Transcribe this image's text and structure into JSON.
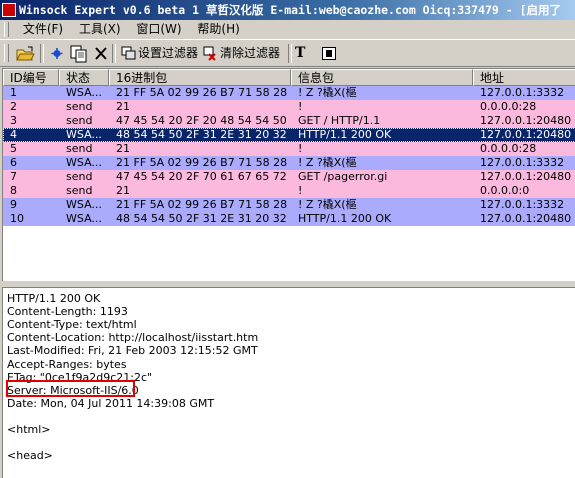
{
  "window": {
    "title": "Winsock Expert v0.6 beta 1 草哲汉化版 E-mail:web@caozhe.com Oicq:337479 - [启用了"
  },
  "menu": [
    "文件(F)",
    "工具(X)",
    "窗口(W)",
    "帮助(H)"
  ],
  "toolbar": {
    "set_filter": "设置过滤器",
    "clear_filter": "清除过滤器",
    "text_label": "T"
  },
  "columns": [
    "ID编号",
    "状态",
    "16进制包",
    "信息包",
    "地址"
  ],
  "rows": [
    {
      "id": "1",
      "status": "WSA...",
      "hex": "21 FF 5A 02 99 26 B7 71 58 28 B...",
      "packet": "!  Z ?橇X(樞",
      "addr": "127.0.0.1:3332",
      "color": "blue"
    },
    {
      "id": "2",
      "status": "send",
      "hex": "21",
      "packet": "!",
      "addr": "0.0.0.0:28",
      "color": "pink"
    },
    {
      "id": "3",
      "status": "send",
      "hex": "47 45 54 20 2F 20 48 54 54 50 2F...",
      "packet": "GET / HTTP/1.1",
      "addr": "127.0.0.1:20480",
      "color": "pink"
    },
    {
      "id": "4",
      "status": "WSA...",
      "hex": "48 54 54 50 2F 31 2E 31 20 32 3...",
      "packet": "HTTP/1.1 200 OK",
      "addr": "127.0.0.1:20480",
      "color": "selected"
    },
    {
      "id": "5",
      "status": "send",
      "hex": "21",
      "packet": "!",
      "addr": "0.0.0.0:28",
      "color": "pink"
    },
    {
      "id": "6",
      "status": "WSA...",
      "hex": "21 FF 5A 02 99 26 B7 71 58 28 B...",
      "packet": "!  Z ?橇X(樞",
      "addr": "127.0.0.1:3332",
      "color": "blue"
    },
    {
      "id": "7",
      "status": "send",
      "hex": "47 45 54 20 2F 70 61 67 65 72 72...",
      "packet": "GET /pagerror.gi",
      "addr": "127.0.0.1:20480",
      "color": "pink"
    },
    {
      "id": "8",
      "status": "send",
      "hex": "21",
      "packet": "!",
      "addr": "0.0.0.0:0",
      "color": "pink"
    },
    {
      "id": "9",
      "status": "WSA...",
      "hex": "21 FF 5A 02 99 26 B7 71 58 28 B...",
      "packet": "!  Z ?橇X(樞",
      "addr": "127.0.0.1:3332",
      "color": "blue"
    },
    {
      "id": "10",
      "status": "WSA...",
      "hex": "48 54 54 50 2F 31 2E 31 20 32 3...",
      "packet": "HTTP/1.1 200 OK",
      "addr": "127.0.0.1:20480",
      "color": "blue"
    }
  ],
  "detail": [
    "HTTP/1.1 200 OK",
    "Content-Length: 1193",
    "Content-Type: text/html",
    "Content-Location: http://localhost/iisstart.htm",
    "Last-Modified: Fri, 21 Feb 2003 12:15:52 GMT",
    "Accept-Ranges: bytes",
    "ETag: \"0ce1f9a2d9c21:2c\"",
    "Server: Microsoft-IIS/6.0",
    "Date: Mon, 04 Jul 2011 14:39:08 GMT",
    "",
    "<html>",
    "",
    "<head>"
  ],
  "colors": {
    "row_blue": "#ababfd",
    "row_pink": "#fbb9dd",
    "row_selected": "#0a246a",
    "highlight_box": "#e00000"
  }
}
